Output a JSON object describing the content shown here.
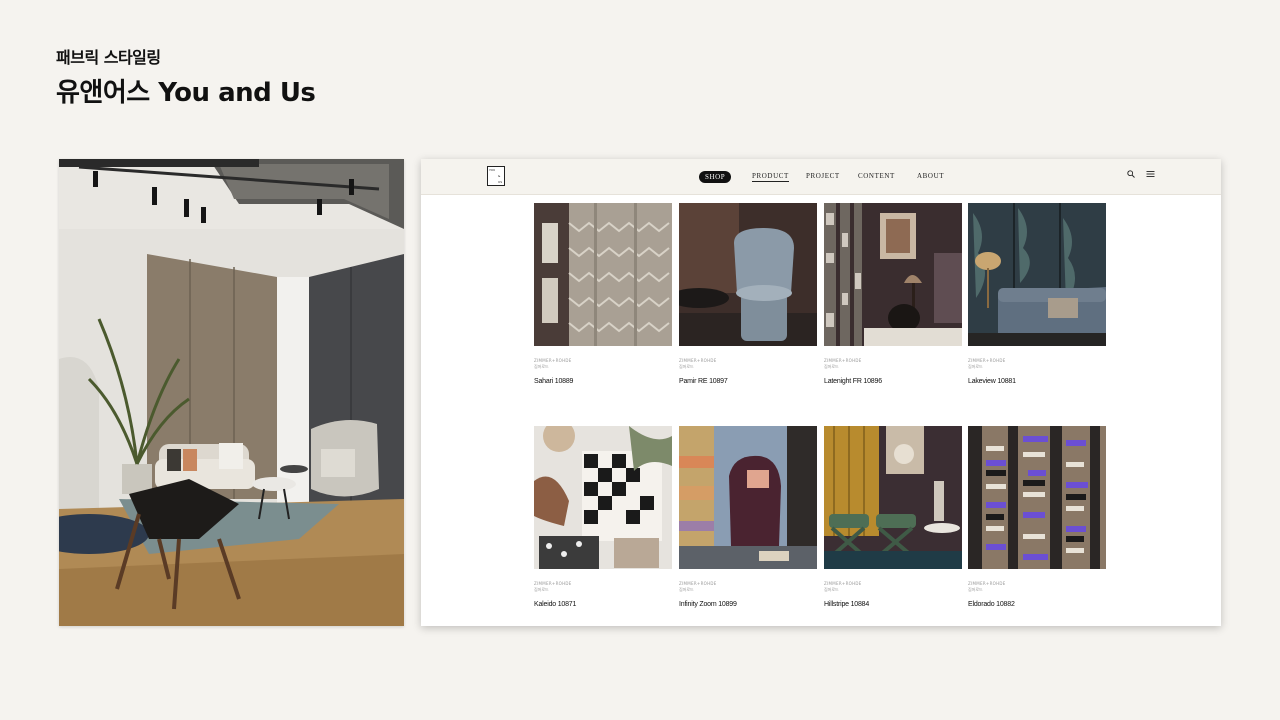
{
  "page": {
    "subtitle": "패브릭 스타일링",
    "title": "유앤어스 You and Us"
  },
  "site": {
    "logo": {
      "line1": "YOU",
      "line2": "&",
      "line3": "US"
    },
    "nav": {
      "shop": "SHOP",
      "product": "PRODUCT",
      "project": "PROJECT",
      "content": "CONTENT",
      "about": "ABOUT"
    },
    "icons": {
      "search": "search-icon",
      "menu": "menu-icon"
    },
    "products": [
      {
        "brand": "ZIMMER+ROHDE",
        "brand_ko": "짐머로드",
        "name": "Sahari 10889",
        "art": "sahari"
      },
      {
        "brand": "ZIMMER+ROHDE",
        "brand_ko": "짐머로드",
        "name": "Pamir RE 10897",
        "art": "pamir"
      },
      {
        "brand": "ZIMMER+ROHDE",
        "brand_ko": "짐머로드",
        "name": "Latenight FR 10896",
        "art": "latenight"
      },
      {
        "brand": "ZIMMER+ROHDE",
        "brand_ko": "짐머로드",
        "name": "Lakeview 10881",
        "art": "lakeview"
      },
      {
        "brand": "ZIMMER+ROHDE",
        "brand_ko": "짐머로드",
        "name": "Kaleido 10871",
        "art": "kaleido"
      },
      {
        "brand": "ZIMMER+ROHDE",
        "brand_ko": "짐머로드",
        "name": "Infinity Zoom 10899",
        "art": "infinity"
      },
      {
        "brand": "ZIMMER+ROHDE",
        "brand_ko": "짐머로드",
        "name": "Hillstripe 10884",
        "art": "hillstripe"
      },
      {
        "brand": "ZIMMER+ROHDE",
        "brand_ko": "짐머로드",
        "name": "Eldorado 10882",
        "art": "eldorado"
      }
    ]
  },
  "colors": {
    "page_bg": "#f5f3ef",
    "header_bg": "#f5f3ee",
    "accent_dark": "#111111",
    "eldorado_purple": "#6b4fd3"
  }
}
